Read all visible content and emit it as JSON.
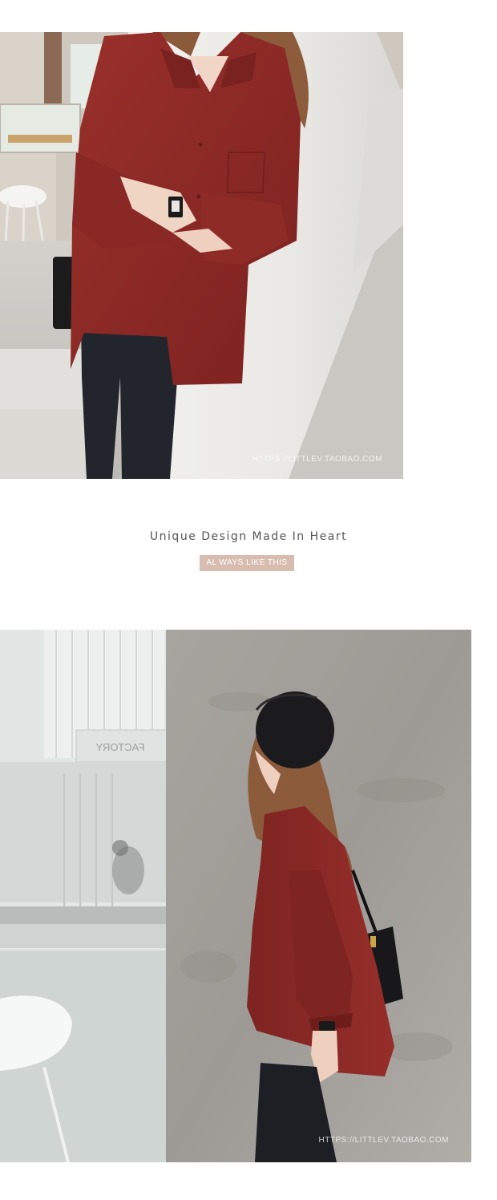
{
  "photo1": {
    "watermark": "HTTPS://LITTLEV.TAOBAO.COM"
  },
  "tagline": {
    "title": "Unique Design Made In Heart",
    "badge": "AL WAYS LIKE THIS"
  },
  "photo2": {
    "watermark": "HTTPS://LITTLEV.TAOBAO.COM",
    "sign_text": "FACTORY"
  },
  "colors": {
    "shirt": "#8e2a26",
    "jeans": "#22252c",
    "badge": "#d8bcb0",
    "wall": "#ededeb",
    "concrete": "#a29f9a"
  }
}
